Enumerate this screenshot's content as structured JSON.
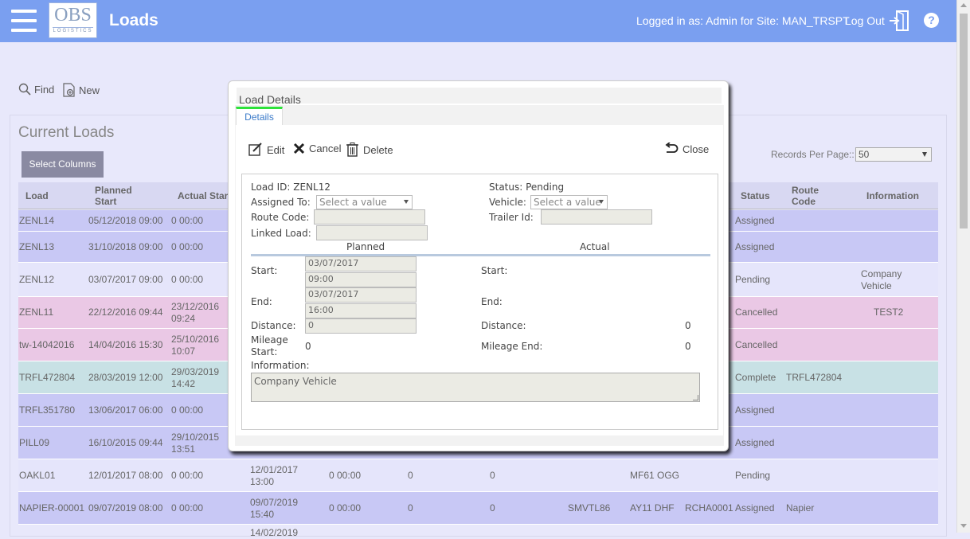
{
  "header": {
    "logo_big": "OBS",
    "logo_small": "LOGISTICS",
    "title": "Loads",
    "logged_in": "Logged in as: Admin for Site: MAN_TRSPT",
    "logout": "Log Out",
    "help": "?"
  },
  "toolbar": {
    "find": "Find",
    "new": "New"
  },
  "panel": {
    "title": "Current Loads",
    "select_columns": "Select Columns",
    "records_label": "Records Per Page::",
    "records_value": "50"
  },
  "table": {
    "headers": {
      "load": "Load",
      "planned_start_1": "Planned",
      "planned_start_2": "Start",
      "actual_start": "Actual Star",
      "status": "Status",
      "route_code_1": "Route",
      "route_code_2": "Code",
      "information": "Information"
    },
    "rows": [
      {
        "load": "ZENL14",
        "planned": "05/12/2018 09:00",
        "actual1": "0 00:00",
        "actual2": "",
        "c4": "",
        "c5": "",
        "c6": "",
        "c7": "",
        "c8": "",
        "c9": "",
        "status": "Assigned",
        "route": "",
        "info1": "",
        "info2": "",
        "color": "#c8c8f5"
      },
      {
        "load": "ZENL13",
        "planned": "31/10/2018 09:00",
        "actual1": "0 00:00",
        "actual2": "",
        "c4": "",
        "c5": "",
        "c6": "",
        "c7": "",
        "c8": "",
        "c9": "",
        "status": "Assigned",
        "route": "",
        "info1": "",
        "info2": "",
        "color": "#c8c8f5"
      },
      {
        "load": "ZENL12",
        "planned": "03/07/2017 09:00",
        "actual1": "0 00:00",
        "actual2": "",
        "c4": "",
        "c5": "",
        "c6": "",
        "c7": "",
        "c8": "",
        "c9": "",
        "status": "Pending",
        "route": "",
        "info1": "Company",
        "info2": "Vehicle",
        "color": "#e5e5fb"
      },
      {
        "load": "ZENL11",
        "planned": "22/12/2016 09:44",
        "actual1": "23/12/2016",
        "actual2": "09:24",
        "c4": "",
        "c5": "",
        "c6": "",
        "c7": "",
        "c8": "",
        "c9": "",
        "status": "Cancelled",
        "route": "",
        "info1": "TEST2",
        "info2": "",
        "color": "#eac8e5"
      },
      {
        "load": "tw-14042016",
        "planned": "14/04/2016 15:30",
        "actual1": "25/10/2016",
        "actual2": "10:07",
        "c4": "",
        "c5": "",
        "c6": "",
        "c7": "",
        "c8": "",
        "c9": "",
        "status": "Cancelled",
        "route": "",
        "info1": "",
        "info2": "",
        "color": "#eac8e5"
      },
      {
        "load": "TRFL472804",
        "planned": "28/03/2019 12:00",
        "actual1": "29/03/2019",
        "actual2": "14:42",
        "c4": "",
        "c5": "",
        "c6": "",
        "c7": "",
        "c8": "",
        "c9": "",
        "status": "Complete",
        "route": "TRFL472804",
        "info1": "",
        "info2": "",
        "color": "#c8e1e5"
      },
      {
        "load": "TRFL351780",
        "planned": "13/06/2017 06:00",
        "actual1": "0 00:00",
        "actual2": "",
        "c4": "",
        "c5": "",
        "c6": "",
        "c7": "",
        "c8": "",
        "c9": "",
        "status": "Assigned",
        "route": "",
        "info1": "",
        "info2": "",
        "color": "#c8c8f5"
      },
      {
        "load": "PILL09",
        "planned": "16/10/2015 09:44",
        "actual1": "29/10/2015",
        "actual2": "13:51",
        "c4": "",
        "c5": "",
        "c6": "",
        "c7": "",
        "c8": "",
        "c9": "",
        "status": "Assigned",
        "route": "",
        "info1": "",
        "info2": "",
        "color": "#c8c8f5"
      },
      {
        "load": "OAKL01",
        "planned": "12/01/2017 08:00",
        "actual1": "0 00:00",
        "actual2": "",
        "c4a": "12/01/2017",
        "c4b": "13:00",
        "c5": "0 00:00",
        "c6": "0",
        "c7": "0",
        "c8": "",
        "c9": "MF61 OGG",
        "c10": "",
        "status": "Pending",
        "route": "",
        "info1": "",
        "info2": "",
        "color": "#e5e5fb"
      },
      {
        "load": "NAPIER-00001",
        "planned": "09/07/2019 08:00",
        "actual1": "0 00:00",
        "actual2": "",
        "c4a": "09/07/2019",
        "c4b": "15:40",
        "c5": "0 00:00",
        "c6": "0",
        "c7": "0",
        "c8": "SMVTL86",
        "c9": "AY11 DHF",
        "c10": "RCHA0001",
        "status": "Assigned",
        "route": "Napier",
        "info1": "",
        "info2": "",
        "color": "#c8c8f5"
      }
    ],
    "partial_row_text": "14/02/2019"
  },
  "modal": {
    "title": "Load Details",
    "tab": "Details",
    "edit": "Edit",
    "cancel": "Cancel",
    "delete": "Delete",
    "close": "Close",
    "load_id": "Load ID: ZENL12",
    "status": "Status: Pending",
    "assigned_to_label": "Assigned To:",
    "assigned_to_value": "Select a value",
    "vehicle_label": "Vehicle:",
    "vehicle_value": "Select a value",
    "route_code_label": "Route Code:",
    "trailer_id_label": "Trailer Id:",
    "linked_load_label": "Linked Load:",
    "planned_header": "Planned",
    "actual_header": "Actual",
    "start_label": "Start:",
    "start_date": "03/07/2017",
    "start_time": "09:00",
    "end_label": "End:",
    "end_date": "03/07/2017",
    "end_time": "16:00",
    "actual_start_label": "Start:",
    "actual_end_label": "End:",
    "distance_label": "Distance:",
    "distance_value": "0",
    "actual_distance_label": "Distance:",
    "actual_distance_value": "0",
    "mileage_start_label_1": "Mileage",
    "mileage_start_label_2": "Start:",
    "mileage_start_value": "0",
    "mileage_end_label": "Mileage End:",
    "mileage_end_value": "0",
    "information_label": "Information:",
    "information_value": "Company Vehicle"
  }
}
